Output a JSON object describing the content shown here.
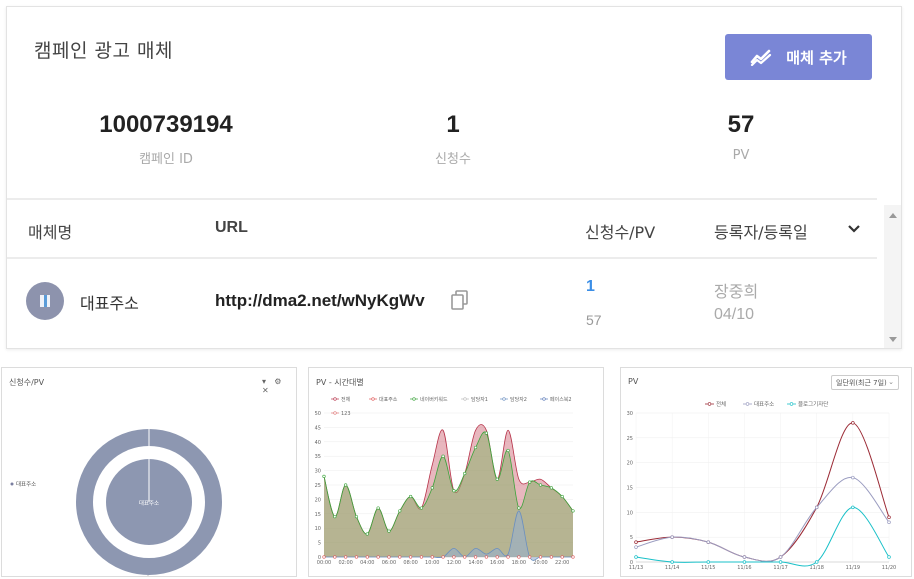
{
  "card": {
    "title": "캠페인 광고 매체",
    "add_button_label": "매체 추가",
    "stats": [
      {
        "value": "1000739194",
        "label": "캠페인 ID"
      },
      {
        "value": "1",
        "label": "신청수"
      },
      {
        "value": "57",
        "label": "PV"
      }
    ],
    "table": {
      "headers": {
        "name": "매체명",
        "url": "URL",
        "apps_pv": "신청수/PV",
        "registrant_date": "등록자/등록일"
      },
      "rows": [
        {
          "name": "대표주소",
          "url": "http://dma2.net/wNyKgWv",
          "applications": "1",
          "pv": "57",
          "registrant": "장중희",
          "date": "04/10"
        }
      ]
    }
  },
  "donut_panel": {
    "title": "신청수/PV",
    "tools": "▾ ⚙ ✕",
    "legend": "대표주소",
    "center_label": "대표주소",
    "bottom_label": "대표주소"
  },
  "pv_hourly_panel": {
    "title": "PV - 시간대별"
  },
  "pv_daily_panel": {
    "title": "PV",
    "select_value": "일단위(최근 7일)"
  },
  "colors": {
    "accent": "#7a86d6",
    "link": "#3b8ee6",
    "donut": "#8d97b1"
  },
  "chart_data": [
    {
      "type": "pie",
      "title": "신청수/PV",
      "categories": [
        "대표주소"
      ],
      "series": [
        {
          "name": "대표주소",
          "values": [
            1
          ]
        },
        {
          "name": "대표주소",
          "values": [
            57
          ]
        }
      ]
    },
    {
      "type": "area",
      "title": "PV - 시간대별",
      "legend": [
        "전체",
        "대표주소",
        "네이버키워드",
        "담당자1",
        "담당자2",
        "페이스북2",
        "123"
      ],
      "x": [
        "00:00",
        "01:00",
        "02:00",
        "03:00",
        "04:00",
        "05:00",
        "06:00",
        "07:00",
        "08:00",
        "09:00",
        "10:00",
        "11:00",
        "12:00",
        "13:00",
        "14:00",
        "15:00",
        "16:00",
        "17:00",
        "18:00",
        "19:00",
        "20:00",
        "21:00",
        "22:00",
        "23:00"
      ],
      "xticks": [
        "00:00",
        "02:00",
        "04:00",
        "06:00",
        "08:00",
        "10:00",
        "12:00",
        "14:00",
        "16:00",
        "18:00",
        "20:00",
        "22:00"
      ],
      "ylim": [
        0,
        50
      ],
      "yticks": [
        0,
        5,
        10,
        15,
        20,
        25,
        30,
        35,
        40,
        45,
        50
      ],
      "series": [
        {
          "name": "전체",
          "values": [
            28,
            14,
            25,
            14,
            8,
            17,
            9,
            16,
            21,
            17,
            32,
            44,
            23,
            29,
            44,
            44,
            27,
            44,
            27,
            26,
            27,
            24,
            21,
            16
          ]
        },
        {
          "name": "대표주소",
          "values": [
            0,
            0,
            0,
            0,
            0,
            0,
            0,
            0,
            0,
            0,
            0,
            0,
            0,
            0,
            0,
            0,
            0,
            0,
            0,
            0,
            0,
            0,
            0,
            0
          ]
        },
        {
          "name": "네이버키워드",
          "values": [
            28,
            14,
            25,
            14,
            8,
            17,
            9,
            16,
            21,
            17,
            24,
            35,
            23,
            29,
            38,
            43,
            27,
            37,
            17,
            26,
            25,
            24,
            21,
            16
          ]
        },
        {
          "name": "담당자1",
          "values": [
            0,
            0,
            0,
            0,
            0,
            0,
            0,
            0,
            0,
            0,
            0,
            0,
            0,
            0,
            0,
            0,
            0,
            0,
            0,
            0,
            0,
            0,
            0,
            0
          ]
        },
        {
          "name": "담당자2",
          "values": [
            0,
            0,
            0,
            0,
            0,
            0,
            0,
            0,
            0,
            0,
            0,
            0,
            3,
            0,
            3,
            1,
            3,
            1,
            16,
            0,
            0,
            0,
            0,
            0
          ]
        },
        {
          "name": "페이스북2",
          "values": [
            0,
            0,
            0,
            0,
            0,
            0,
            0,
            0,
            0,
            0,
            0,
            0,
            0,
            0,
            0,
            0,
            0,
            0,
            0,
            0,
            0,
            0,
            0,
            0
          ]
        },
        {
          "name": "123",
          "values": [
            0,
            0,
            0,
            0,
            0,
            0,
            0,
            0,
            0,
            0,
            0,
            0,
            0,
            0,
            0,
            0,
            0,
            0,
            0,
            0,
            0,
            0,
            0,
            0
          ]
        }
      ]
    },
    {
      "type": "line",
      "title": "PV",
      "legend": [
        "전체",
        "대표주소",
        "블로그기자단"
      ],
      "x": [
        "11/13",
        "11/14",
        "11/15",
        "11/16",
        "11/17",
        "11/18",
        "11/19",
        "11/20"
      ],
      "ylim": [
        0,
        30
      ],
      "yticks": [
        0,
        5,
        10,
        15,
        20,
        25,
        30
      ],
      "series": [
        {
          "name": "전체",
          "values": [
            4,
            5,
            4,
            1,
            1,
            11,
            28,
            9
          ]
        },
        {
          "name": "대표주소",
          "values": [
            3,
            5,
            4,
            1,
            1,
            11,
            17,
            8
          ]
        },
        {
          "name": "블로그기자단",
          "values": [
            1,
            0,
            0,
            0,
            0,
            0,
            11,
            1
          ]
        }
      ]
    }
  ]
}
